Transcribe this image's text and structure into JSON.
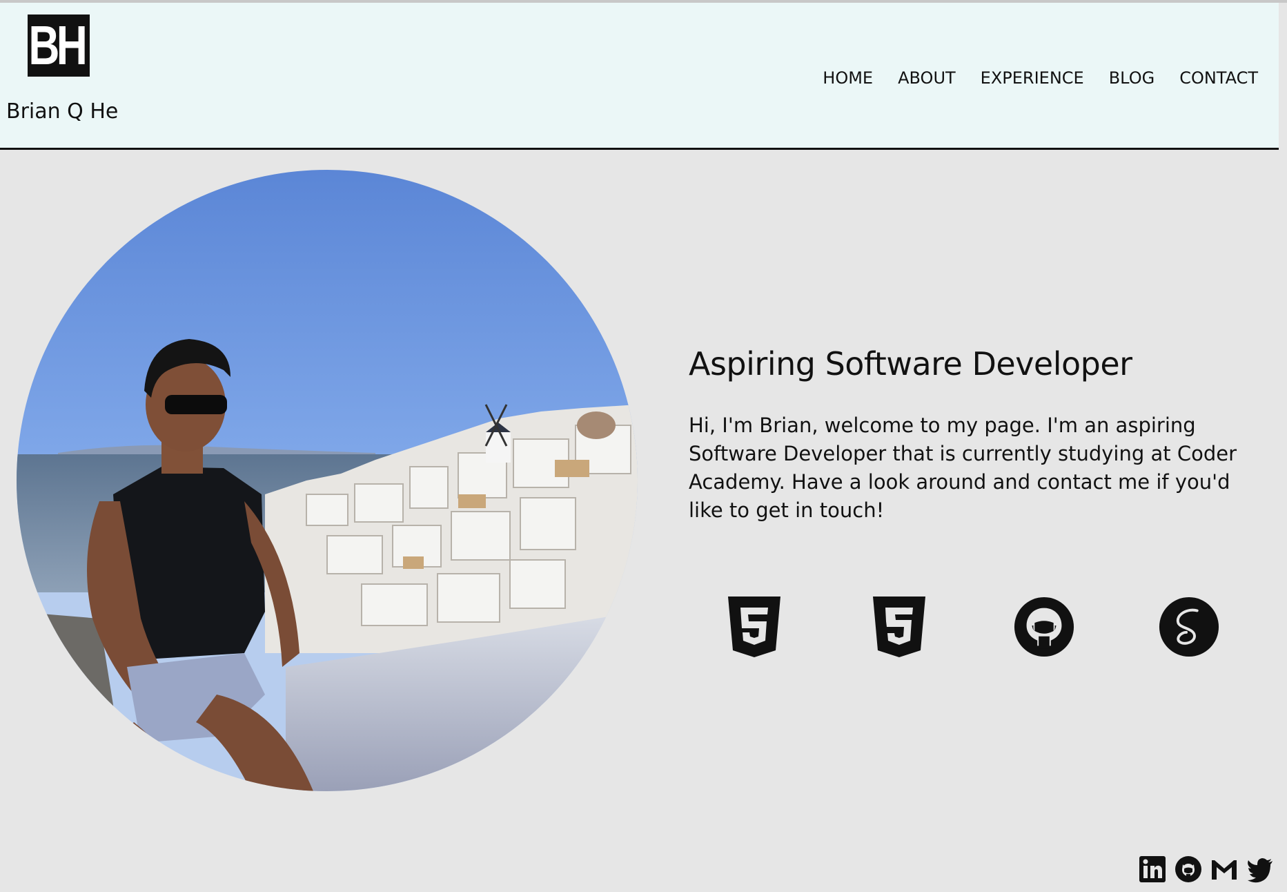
{
  "header": {
    "logo_text": "BH",
    "site_name": "Brian Q He",
    "nav": [
      "HOME",
      "ABOUT",
      "EXPERIENCE",
      "BLOG",
      "CONTACT"
    ]
  },
  "main": {
    "heading": "Aspiring Software Developer",
    "intro": "Hi, I'm Brian, welcome to my page. I'm an aspiring Software Developer that is currently studying at Coder Academy. Have a look around and contact me if you'd like to get in touch!",
    "tech_icons": [
      "html5-icon",
      "css3-icon",
      "github-icon",
      "sass-icon"
    ]
  },
  "footer": {
    "social_icons": [
      "linkedin-icon",
      "github-icon",
      "gmail-icon",
      "twitter-icon"
    ]
  },
  "colors": {
    "header_bg": "#ebf7f7",
    "page_bg": "#e6e6e6",
    "text": "#111111"
  }
}
